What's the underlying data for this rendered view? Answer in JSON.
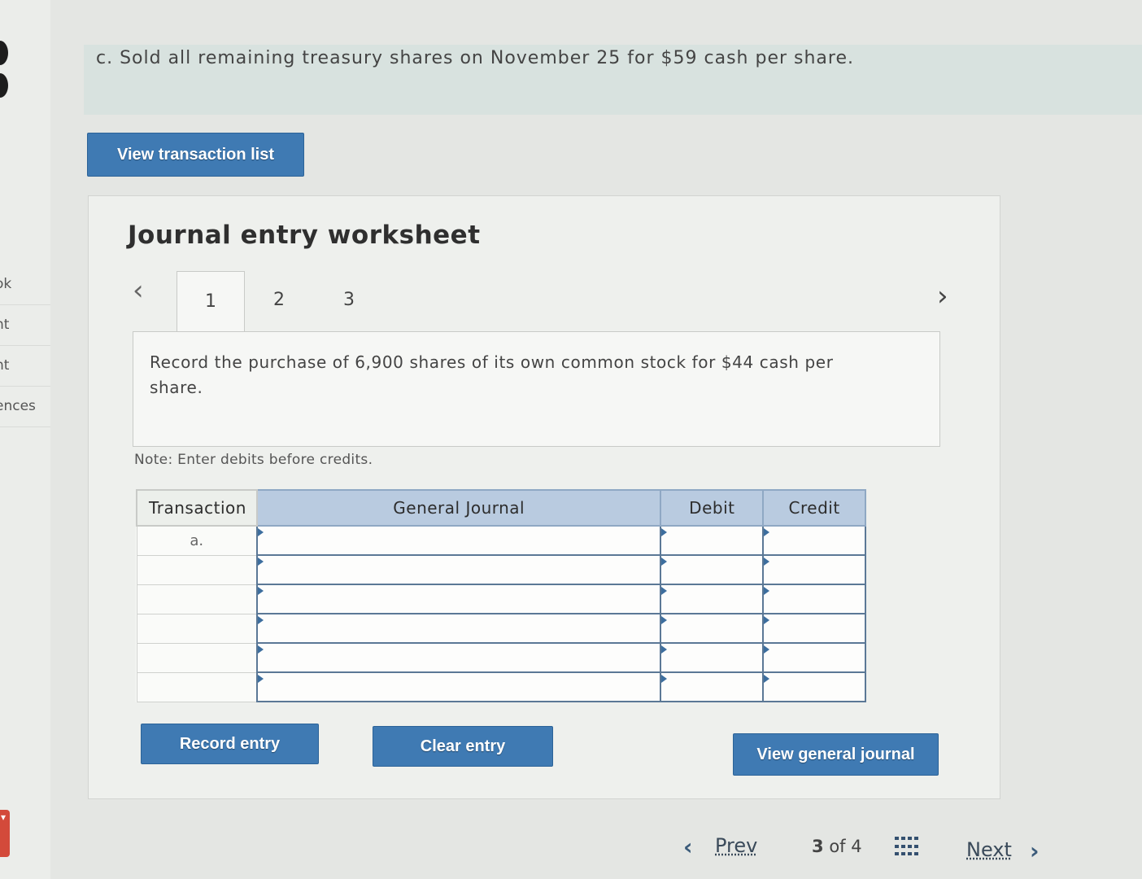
{
  "prompt_banner": {
    "text": "c. Sold all remaining treasury shares on November 25 for $59 cash per share."
  },
  "buttons": {
    "view_transaction_list": "View transaction list",
    "record_entry": "Record entry",
    "clear_entry": "Clear entry",
    "view_general_journal": "View general journal"
  },
  "side_nav": {
    "items": [
      "ok",
      "nt",
      "nt",
      "ences"
    ]
  },
  "worksheet": {
    "title": "Journal entry worksheet",
    "tabs": [
      "1",
      "2",
      "3"
    ],
    "active_tab": "1",
    "instruction": "Record the purchase of 6,900 shares of its own common stock for $44 cash per share.",
    "note": "Note: Enter debits before credits."
  },
  "journal_table": {
    "headers": [
      "Transaction",
      "General Journal",
      "Debit",
      "Credit"
    ],
    "rows": [
      {
        "transaction": "a.",
        "general_journal": "",
        "debit": "",
        "credit": ""
      },
      {
        "transaction": "",
        "general_journal": "",
        "debit": "",
        "credit": ""
      },
      {
        "transaction": "",
        "general_journal": "",
        "debit": "",
        "credit": ""
      },
      {
        "transaction": "",
        "general_journal": "",
        "debit": "",
        "credit": ""
      },
      {
        "transaction": "",
        "general_journal": "",
        "debit": "",
        "credit": ""
      },
      {
        "transaction": "",
        "general_journal": "",
        "debit": "",
        "credit": ""
      }
    ]
  },
  "pager": {
    "prev": "Prev",
    "current": "3",
    "of": "of",
    "total": "4",
    "next": "Next"
  },
  "colors": {
    "button_blue": "#3f7ab3",
    "header_blue": "#b9cbe0",
    "banner_bg": "#d8e2df"
  },
  "icons": {
    "tab_prev": "chevron-left-icon",
    "tab_next": "chevron-right-icon",
    "pager_prev": "chevron-left-icon",
    "pager_next": "chevron-right-icon",
    "grid": "grid-icon"
  }
}
